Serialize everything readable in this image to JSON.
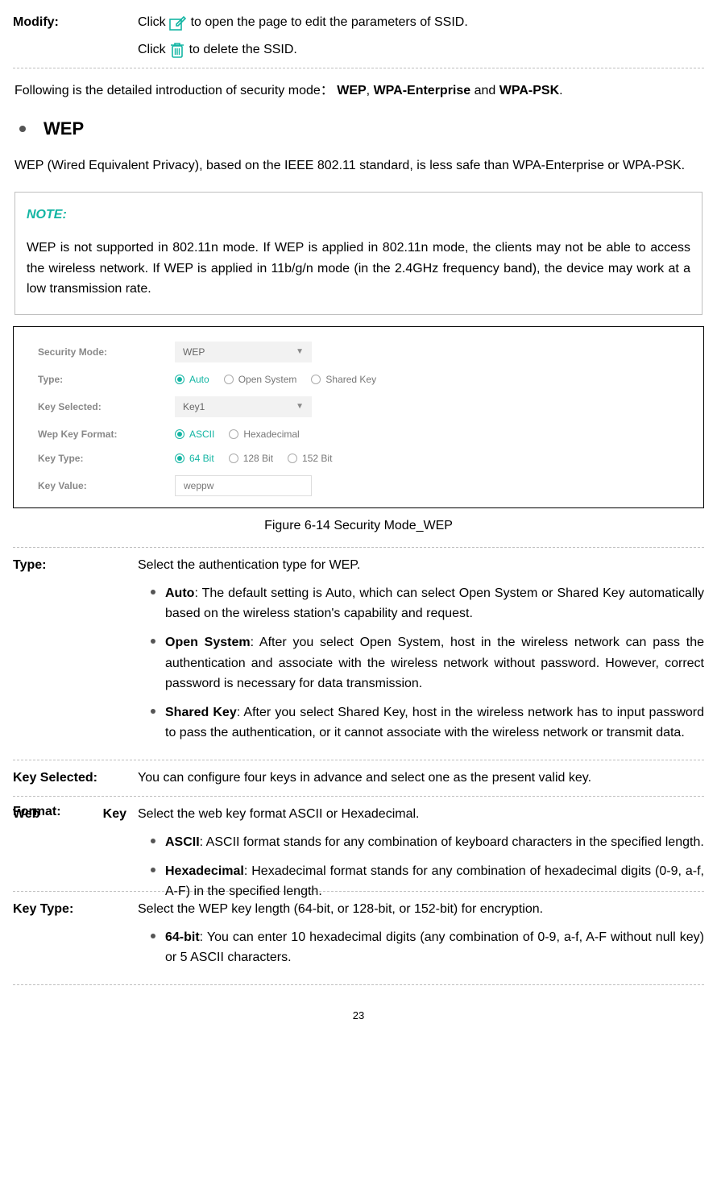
{
  "modify": {
    "label": "Modify:",
    "line1_pre": "Click ",
    "line1_post": " to open the page to edit the parameters of SSID.",
    "line2_pre": "Click ",
    "line2_post": " to delete the SSID."
  },
  "intro_line_pre": "Following is the detailed introduction of security mode：",
  "intro_wep": "WEP",
  "intro_sep1": ", ",
  "intro_wpaent": "WPA-Enterprise",
  "intro_and": " and ",
  "intro_wpapsk": "WPA-PSK",
  "intro_end": ".",
  "wep_heading": "WEP",
  "wep_para": "WEP (Wired Equivalent Privacy), based on the IEEE 802.11 standard, is less safe than WPA-Enterprise or WPA-PSK.",
  "note_title": "NOTE:",
  "note_body": "WEP is not supported in 802.11n mode. If WEP is applied in 802.11n mode, the clients may not be able to access the wireless network. If WEP is applied in 11b/g/n mode (in the 2.4GHz frequency band), the device may work at a low transmission rate.",
  "config": {
    "security_mode_label": "Security Mode:",
    "security_mode_value": "WEP",
    "type_label": "Type:",
    "type_opts": {
      "auto": "Auto",
      "open": "Open System",
      "shared": "Shared Key"
    },
    "key_selected_label": "Key Selected:",
    "key_selected_value": "Key1",
    "wep_format_label": "Wep Key Format:",
    "wep_format_opts": {
      "ascii": "ASCII",
      "hex": "Hexadecimal"
    },
    "key_type_label": "Key Type:",
    "key_type_opts": {
      "b64": "64 Bit",
      "b128": "128 Bit",
      "b152": "152 Bit"
    },
    "key_value_label": "Key Value:",
    "key_value_value": "weppw"
  },
  "figure_caption": "Figure 6-14 Security Mode_WEP",
  "type": {
    "label": "Type:",
    "intro": "Select the authentication type for WEP.",
    "auto_b": "Auto",
    "auto_t": ": The default setting is Auto, which can select Open System or Shared Key automatically based on the wireless station's capability and request.",
    "open_b": "Open System",
    "open_t": ": After you select Open System, host in the wireless network can pass the authentication and associate with the wireless network without password. However, correct password is necessary for data transmission.",
    "shared_b": "Shared Key",
    "shared_t": ": After you select Shared Key, host in the wireless network has to input password to pass the authentication, or it cannot associate with the wireless network or transmit data."
  },
  "key_selected": {
    "label": "Key Selected:",
    "text": "You can configure four keys in advance and select one as the present valid key."
  },
  "web_key_format": {
    "label_a": "Web",
    "label_b": "Key",
    "label_c": "Format:",
    "intro": "Select the web key format ASCII or Hexadecimal.",
    "ascii_b": "ASCII",
    "ascii_t": ": ASCII format stands for any combination of keyboard characters in the specified length.",
    "hex_b": "Hexadecimal",
    "hex_t": ": Hexadecimal format stands for any combination of hexadecimal digits (0-9, a-f, A-F) in the specified length."
  },
  "key_type": {
    "label": "Key Type:",
    "intro": "Select the WEP key length (64-bit, or 128-bit, or 152-bit) for encryption.",
    "b64_b": "64-bit",
    "b64_t": ": You can enter 10 hexadecimal digits (any combination of 0-9, a-f, A-F without null key) or 5 ASCII characters."
  },
  "page_number": "23"
}
